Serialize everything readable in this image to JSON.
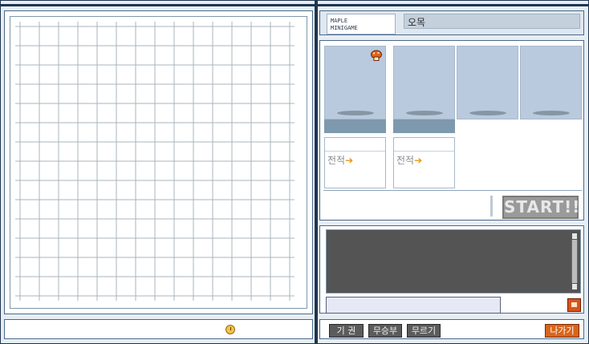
{
  "header": {
    "logo_line1": "MAPLE",
    "logo_line2": "MINIGAME",
    "game_title": "오목"
  },
  "players": [
    {
      "record_label": "전적",
      "record_arrow": "➔",
      "avatar_icon": "mushroom-icon"
    },
    {
      "record_label": "전적",
      "record_arrow": "➔"
    }
  ],
  "start_button": "START!!",
  "bottom_buttons": {
    "giveup": "기 권",
    "draw": "무승부",
    "undo": "무르기",
    "exit": "나가기"
  },
  "icons": {
    "timer": "clock-icon",
    "chat_action": "emoticon-icon"
  },
  "colors": {
    "frame": "#1f3550",
    "slot": "#b9cade",
    "start_disabled": "#9a9a9a",
    "exit": "#d9651c"
  }
}
